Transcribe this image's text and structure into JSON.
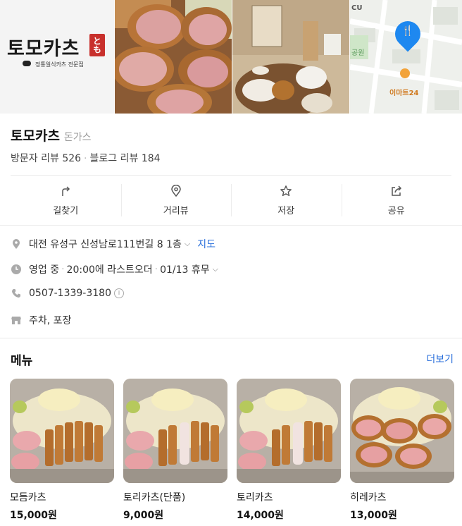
{
  "photos": {
    "logo": {
      "name": "토모카츠",
      "seal": "とも",
      "subtitle": "정통일식카츠 전문점"
    },
    "map": {
      "labels": {
        "cu": "CU",
        "park": "공원",
        "emart": "이마트24"
      }
    }
  },
  "place": {
    "name": "토모카츠",
    "category": "돈가스",
    "visitor_reviews_label": "방문자 리뷰",
    "visitor_reviews_count": "526",
    "blog_reviews_label": "블로그 리뷰",
    "blog_reviews_count": "184"
  },
  "actions": [
    {
      "label": "길찾기",
      "icon": "directions-icon"
    },
    {
      "label": "거리뷰",
      "icon": "location-pin-icon"
    },
    {
      "label": "저장",
      "icon": "star-icon"
    },
    {
      "label": "공유",
      "icon": "share-icon"
    }
  ],
  "info": {
    "address": "대전 유성구 신성남로111번길 8 1층",
    "map_link": "지도",
    "hours_status": "영업 중",
    "hours_detail": "20:00에 라스트오더",
    "holiday": "01/13 휴무",
    "phone": "0507-1339-3180",
    "amenities": "주차, 포장"
  },
  "menu": {
    "title": "메뉴",
    "more": "더보기",
    "items": [
      {
        "name": "모듬카츠",
        "price": "15,000원"
      },
      {
        "name": "토리카츠(단품)",
        "price": "9,000원"
      },
      {
        "name": "토리카츠",
        "price": "14,000원"
      },
      {
        "name": "히레카츠",
        "price": "13,000원"
      }
    ]
  },
  "colors": {
    "link": "#2a6fdb",
    "map_pin": "#1e88f0",
    "logo_seal": "#c8302c"
  }
}
